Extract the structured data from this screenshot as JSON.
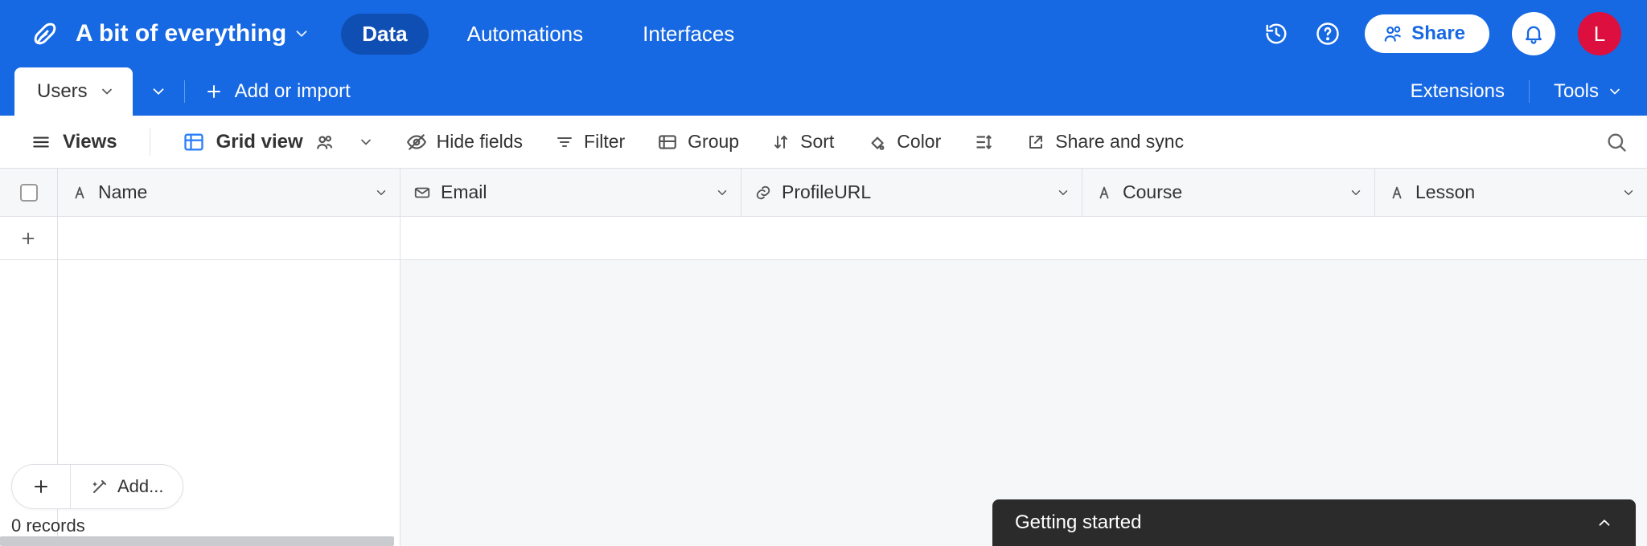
{
  "topbar": {
    "base_title": "A bit of everything",
    "nav": {
      "data": "Data",
      "automations": "Automations",
      "interfaces": "Interfaces"
    },
    "share_label": "Share",
    "avatar_initial": "L"
  },
  "tabstrip": {
    "active_table": "Users",
    "add_import": "Add or import",
    "extensions": "Extensions",
    "tools": "Tools"
  },
  "toolbar": {
    "views": "Views",
    "view_name": "Grid view",
    "hide_fields": "Hide fields",
    "filter": "Filter",
    "group": "Group",
    "sort": "Sort",
    "color": "Color",
    "share_sync": "Share and sync"
  },
  "columns": {
    "name": "Name",
    "email": "Email",
    "profileurl": "ProfileURL",
    "course": "Course",
    "lesson": "Lesson"
  },
  "footer": {
    "add_ellipsis": "Add...",
    "record_count": "0 records"
  },
  "panel": {
    "getting_started": "Getting started"
  }
}
